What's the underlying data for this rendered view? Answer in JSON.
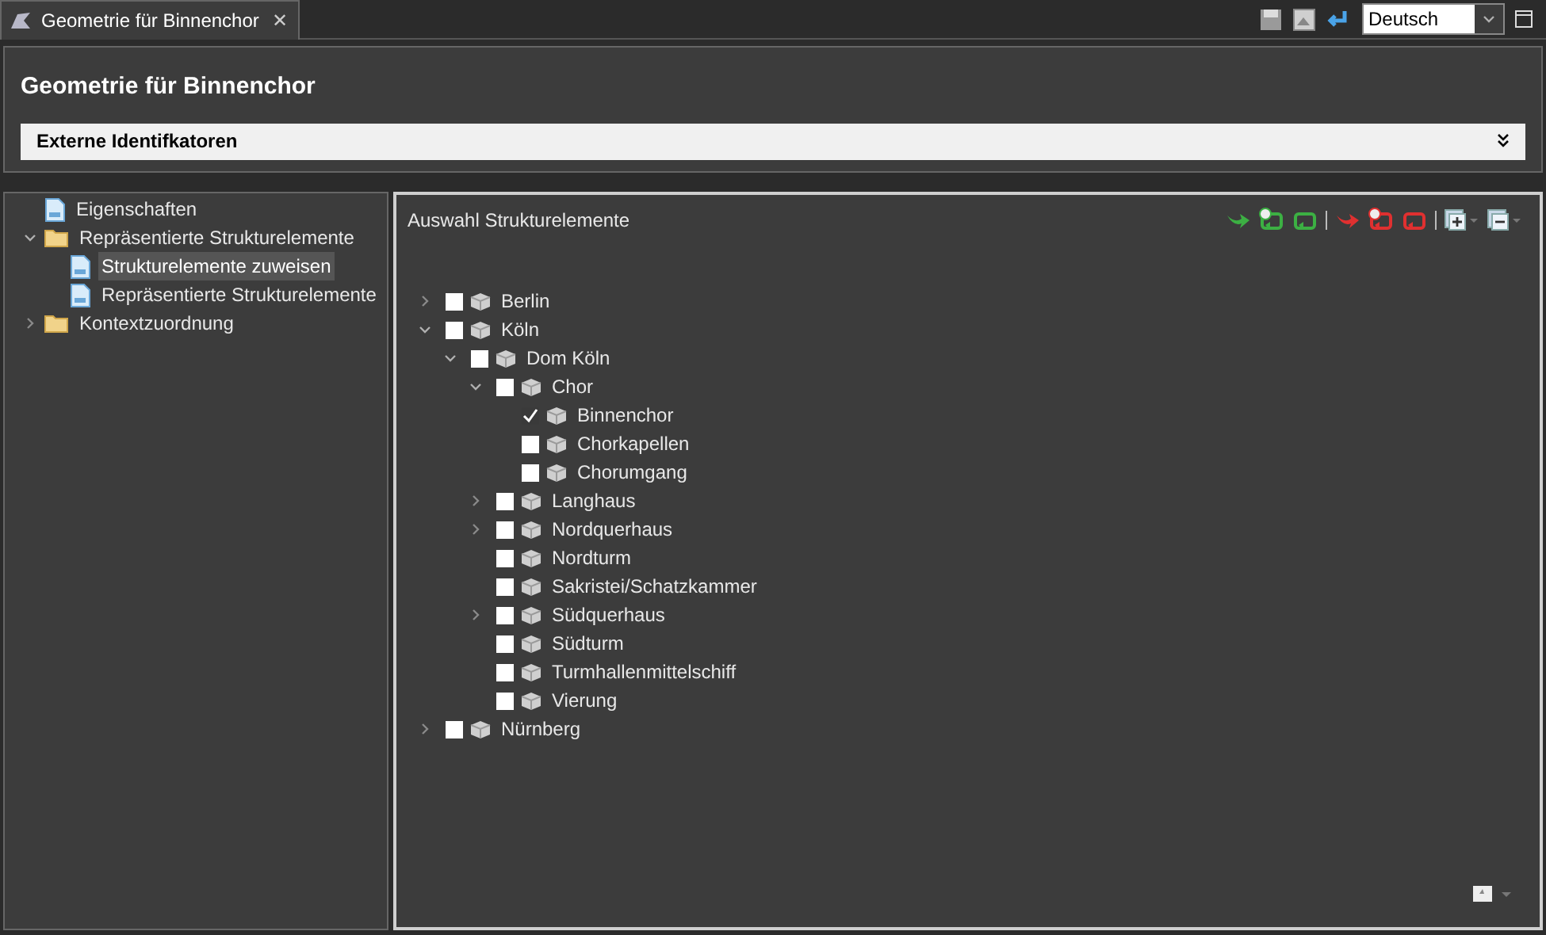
{
  "editor_tab": {
    "title": "Geometrie für Binnenchor",
    "close": "✕"
  },
  "language_select": {
    "value": "Deutsch"
  },
  "header": {
    "title": "Geometrie für Binnenchor",
    "section": {
      "label": "Externe Identifkatoren",
      "expanded": false
    }
  },
  "navigation": [
    {
      "label": "Eigenschaften",
      "kind": "page",
      "selected": false
    },
    {
      "label": "Repräsentierte Strukturelemente",
      "kind": "folder",
      "selected": false,
      "expanded": true,
      "children": [
        {
          "label": "Strukturelemente zuweisen",
          "kind": "page",
          "selected": true
        },
        {
          "label": "Repräsentierte Strukturelemente",
          "kind": "page",
          "selected": false
        }
      ]
    },
    {
      "label": "Kontextzuordnung",
      "kind": "folder",
      "selected": false,
      "expanded": false
    }
  ],
  "selection_panel": {
    "title": "Auswahl Strukturelemente",
    "tree": [
      {
        "label": "Berlin",
        "checked": false,
        "expanded": false
      },
      {
        "label": "Köln",
        "checked": false,
        "expanded": true,
        "children": [
          {
            "label": "Dom Köln",
            "checked": false,
            "expanded": true,
            "children": [
              {
                "label": "Chor",
                "checked": false,
                "expanded": true,
                "children": [
                  {
                    "label": "Binnenchor",
                    "checked": true
                  },
                  {
                    "label": "Chorkapellen",
                    "checked": false
                  },
                  {
                    "label": "Chorumgang",
                    "checked": false
                  }
                ]
              },
              {
                "label": "Langhaus",
                "checked": false,
                "expanded": false
              },
              {
                "label": "Nordquerhaus",
                "checked": false,
                "expanded": false
              },
              {
                "label": "Nordturm",
                "checked": false
              },
              {
                "label": "Sakristei/Schatzkammer",
                "checked": false
              },
              {
                "label": "Südquerhaus",
                "checked": false,
                "expanded": false
              },
              {
                "label": "Südturm",
                "checked": false
              },
              {
                "label": "Turmhallenmittelschiff",
                "checked": false
              },
              {
                "label": "Vierung",
                "checked": false
              }
            ]
          }
        ]
      },
      {
        "label": "Nürnberg",
        "checked": false,
        "expanded": false
      }
    ]
  }
}
